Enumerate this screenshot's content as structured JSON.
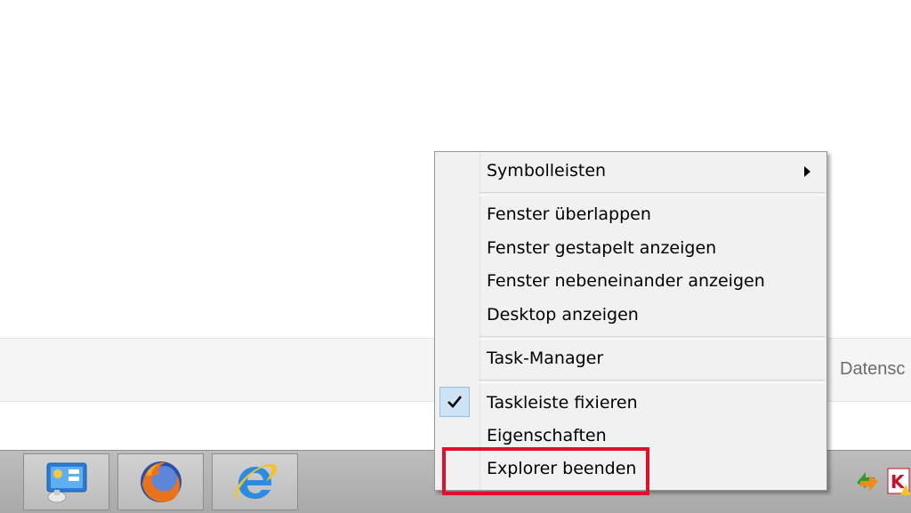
{
  "background": {
    "partial_text": "Datensc"
  },
  "context_menu": {
    "items": [
      {
        "label": "Symbolleisten",
        "submenu": true
      },
      {
        "label": "Fenster überlappen"
      },
      {
        "label": "Fenster gestapelt anzeigen"
      },
      {
        "label": "Fenster nebeneinander anzeigen"
      },
      {
        "label": "Desktop anzeigen"
      },
      {
        "label": "Task-Manager"
      },
      {
        "label": "Taskleiste fixieren",
        "checked": true
      },
      {
        "label": "Eigenschaften"
      },
      {
        "label": "Explorer beenden",
        "highlighted": true
      }
    ]
  },
  "taskbar": {
    "pinned": [
      {
        "icon": "control-panel-icon"
      },
      {
        "icon": "firefox-icon"
      },
      {
        "icon": "internet-explorer-icon"
      }
    ],
    "tray_icons": [
      "update-icon",
      "kaspersky-warning-icon"
    ]
  },
  "colors": {
    "highlight_frame": "#e0102b",
    "menu_bg": "#f1f1f1",
    "taskbar_bg": "#b3b3b3",
    "check_bg": "#cfe3f6"
  }
}
